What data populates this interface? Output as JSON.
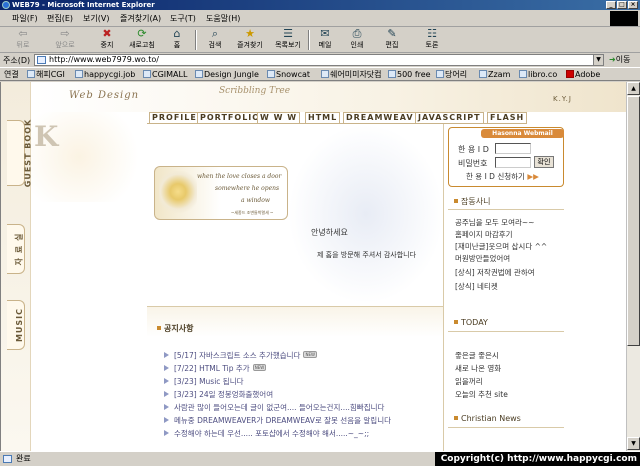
{
  "window": {
    "title": "WEB79 - Microsoft Internet Explorer"
  },
  "menu": [
    "파일(F)",
    "편집(E)",
    "보기(V)",
    "즐겨찾기(A)",
    "도구(T)",
    "도움말(H)"
  ],
  "toolbar": [
    {
      "label": "뒤로",
      "icon": "back-arrow-icon",
      "glyph": "⇦",
      "enabled": false
    },
    {
      "label": "앞으로",
      "icon": "forward-arrow-icon",
      "glyph": "⇨",
      "enabled": false
    },
    {
      "label": "중지",
      "icon": "stop-icon",
      "glyph": "✖",
      "enabled": true
    },
    {
      "label": "새로고침",
      "icon": "refresh-icon",
      "glyph": "⟳",
      "enabled": true
    },
    {
      "label": "홈",
      "icon": "home-icon",
      "glyph": "⌂",
      "enabled": true
    },
    {
      "label": "검색",
      "icon": "search-icon",
      "glyph": "⌕",
      "enabled": true
    },
    {
      "label": "즐겨찾기",
      "icon": "favorites-icon",
      "glyph": "★",
      "enabled": true
    },
    {
      "label": "목록보기",
      "icon": "history-icon",
      "glyph": "☰",
      "enabled": true
    },
    {
      "label": "메일",
      "icon": "mail-icon",
      "glyph": "✉",
      "enabled": true
    },
    {
      "label": "인쇄",
      "icon": "print-icon",
      "glyph": "⎙",
      "enabled": true
    },
    {
      "label": "편집",
      "icon": "edit-icon",
      "glyph": "✎",
      "enabled": true
    },
    {
      "label": "토론",
      "icon": "discuss-icon",
      "glyph": "☷",
      "enabled": true
    }
  ],
  "address": {
    "label": "주소(D)",
    "url": "http://www.web7979.wo.to/",
    "go": "이동"
  },
  "links": {
    "label": "연결",
    "items": [
      "해피CGI",
      "happycgi.job",
      "CGIMALL",
      "Design Jungle",
      "Snowcat",
      "쉐어미미자닷컴",
      "500 free",
      "당어리",
      "Zzam",
      "libro.co",
      "Adobe"
    ]
  },
  "site": {
    "side_tabs": [
      "GUEST BOOK",
      "자 료 실",
      "MUSIC"
    ],
    "logo_left": "Web Design",
    "logo_right": "Scribbling Tree",
    "author": "K.Y.J",
    "nav": [
      "PROFILE",
      "PORTFOLIO",
      "W W W",
      "HTML",
      "DREAMWEAV",
      "JAVASCRIPT",
      "FLASH"
    ],
    "poem": [
      "when the love closes a door",
      "somewhere he opens",
      "a window"
    ],
    "poem_sign": "~세종드 조변들박렬세 ~",
    "greeting1": "안녕하세요",
    "greeting2": "제 홈을 방문해 주셔서 감사합니다",
    "notice_title": "공지사항",
    "notices": [
      {
        "text": "[5/17] 자바스크립트 소스 추가했습니다",
        "new": "NEW"
      },
      {
        "text": "[7/22] HTML Tip 추가",
        "new": "NEW"
      },
      {
        "text": "[3/23] Music 됩니다",
        "new": ""
      },
      {
        "text": "[3/23] 24일 정봉엉화출했어여",
        "new": ""
      },
      {
        "text": "사람관 많이 들어오는데 글이 없군여.... 들어오는건지....힘빠집니다",
        "new": ""
      },
      {
        "text": "메뉴중 DREAMWEAVER가 DREAMWEAV로 잘못 선음을 알립니다",
        "new": ""
      },
      {
        "text": "수정해야 하는데 우선..... 포토샵에서 수정해야 해서.....~_~;;",
        "new": ""
      }
    ],
    "login": {
      "title": "Hasonna Webmail",
      "id_label": "한 용 I D",
      "pw_label": "비밀번호",
      "button": "확인",
      "signup": "한 용 I D 신청하기",
      "signup_arrow": "▶▶"
    },
    "sections": [
      {
        "title": "잡동사니",
        "items": [
          "공주님을 모두 모여라~~",
          "홈페이지 마감후기",
          "[재미난글]웃으며 삽시다 ^^",
          "머원방만들었어여",
          "[상식] 저작권법에 관하여",
          "[상식] 네티켓"
        ]
      },
      {
        "title": "TODAY",
        "items": [
          "좋은글 좋은시",
          "새로 나온 영화",
          "읽을꺼리",
          "오늘의 추천 site"
        ]
      },
      {
        "title": "Christian News",
        "items": []
      }
    ]
  },
  "status": {
    "text": "완료",
    "copyright": "Copyright(c) http://www.happycgi.com"
  }
}
